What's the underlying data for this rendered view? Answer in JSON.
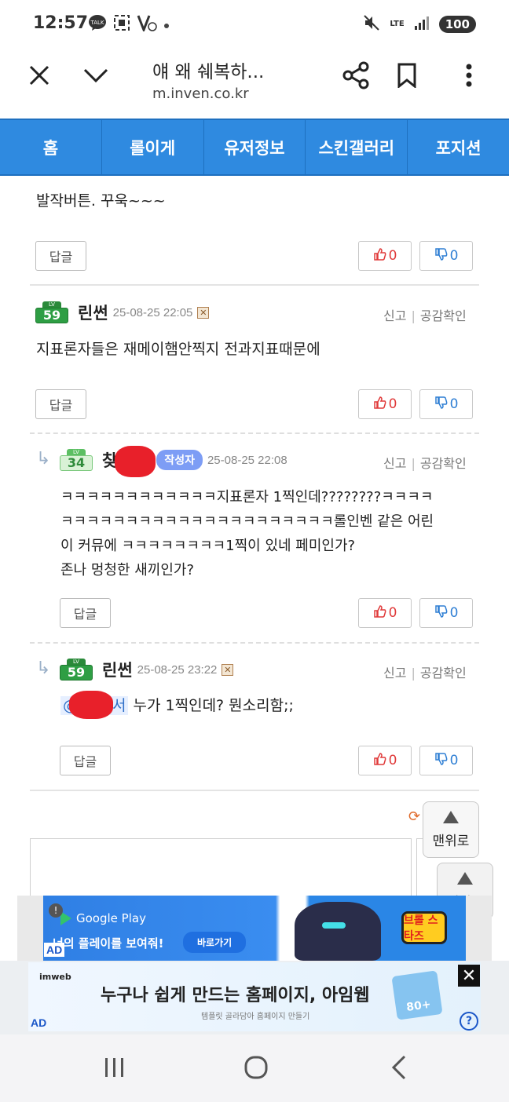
{
  "status_bar": {
    "time": "12:57",
    "battery": "100",
    "network": "LTE"
  },
  "browser": {
    "title": "얘 왜 쉐복하...",
    "url": "m.inven.co.kr"
  },
  "site_nav": [
    "홈",
    "롤이게",
    "유저정보",
    "스킨갤러리",
    "포지션"
  ],
  "comments": {
    "c0": {
      "text": "발작버튼. 꾸욱~~~",
      "reply": "답글",
      "up": "0",
      "down": "0"
    },
    "c1": {
      "level": "59",
      "nick": "린썬",
      "date": "25-08-25 22:05",
      "report": "신고",
      "like_check": "공감확인",
      "text": "지표론자들은 재메이햄안찍지 전과지표때문에",
      "reply": "답글",
      "up": "0",
      "down": "0"
    },
    "c2": {
      "level": "34",
      "nick": "찾",
      "author_badge": "작성자",
      "date": "25-08-25 22:08",
      "report": "신고",
      "like_check": "공감확인",
      "lines": [
        "ㅋㅋㅋㅋㅋㅋㅋㅋㅋㅋㅋㅋ지표론자 1찍인데????????ㅋㅋㅋㅋ",
        "ㅋㅋㅋㅋㅋㅋㅋㅋㅋㅋㅋㅋㅋㅋㅋㅋㅋㅋㅋㅋㅋ롤인벤 같은 어린",
        "이 커뮤에 ㅋㅋㅋㅋㅋㅋㅋㅋ1찍이 있네 페미인가?",
        "존나 멍청한 새끼인가?"
      ],
      "reply": "답글",
      "up": "0",
      "down": "0"
    },
    "c3": {
      "level": "59",
      "nick": "린썬",
      "date": "25-08-25 23:22",
      "report": "신고",
      "like_check": "공감확인",
      "mention": "@",
      "mention_tail": "서",
      "text": " 누가 1찍인데? 뭔소리함;;",
      "reply": "답글",
      "up": "0",
      "down": "0"
    }
  },
  "level_label": "LV",
  "to_top": "맨위로",
  "ads": {
    "ad1": {
      "store": "Google Play",
      "text": "너의 플레이를 보여줘!",
      "button": "바로가기",
      "game_logo": "브롤 스타즈",
      "label": "AD"
    },
    "ad2": {
      "brand": "imweb",
      "title": "누구나 쉽게 만드는 홈페이지, 아임웹",
      "sub": "템플릿 골라담아 홈페이지 만들기",
      "badge": "80+",
      "label": "AD"
    }
  },
  "icons": [
    "close-icon",
    "chevron-down-icon",
    "share-icon",
    "bookmark-icon",
    "more-icon",
    "thumb-up-icon",
    "thumb-down-icon",
    "reply-arrow-icon",
    "refresh-icon",
    "recents-icon",
    "home-icon",
    "back-icon"
  ],
  "colors": {
    "nav_blue": "#2f8ae0",
    "like_red": "#e03a3a",
    "dislike_blue": "#2f7fd4",
    "level_green": "#2e9e44",
    "author_badge": "#7d9df5"
  }
}
